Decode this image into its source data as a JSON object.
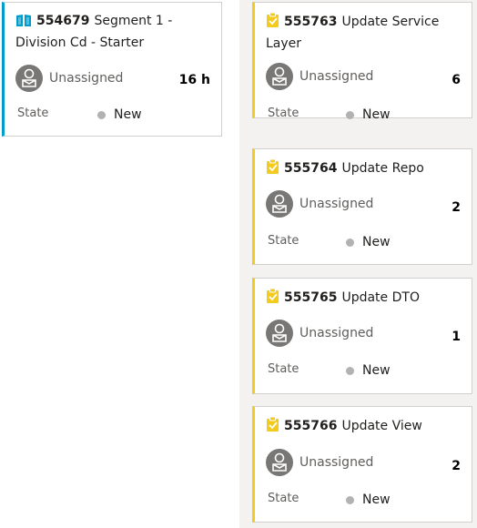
{
  "colors": {
    "story_accent": "#009ccc",
    "task_accent": "#f2cb1d",
    "state_new_dot": "#b2b2b2"
  },
  "story_card": {
    "icon": "book-icon",
    "id": "554679",
    "title": "Segment 1 - Division Cd - Starter",
    "assignee": "Unassigned",
    "effort": "16 h",
    "state_label": "State",
    "state_value": "New"
  },
  "task_cards": [
    {
      "icon": "task-clipboard-icon",
      "id": "555763",
      "title": "Update Service Layer",
      "assignee": "Unassigned",
      "effort": "6",
      "state_label": "State",
      "state_value": "New"
    },
    {
      "icon": "task-clipboard-icon",
      "id": "555764",
      "title": "Update Repo",
      "assignee": "Unassigned",
      "effort": "2",
      "state_label": "State",
      "state_value": "New"
    },
    {
      "icon": "task-clipboard-icon",
      "id": "555765",
      "title": "Update DTO",
      "assignee": "Unassigned",
      "effort": "1",
      "state_label": "State",
      "state_value": "New"
    },
    {
      "icon": "task-clipboard-icon",
      "id": "555766",
      "title": "Update View",
      "assignee": "Unassigned",
      "effort": "2",
      "state_label": "State",
      "state_value": "New"
    }
  ]
}
